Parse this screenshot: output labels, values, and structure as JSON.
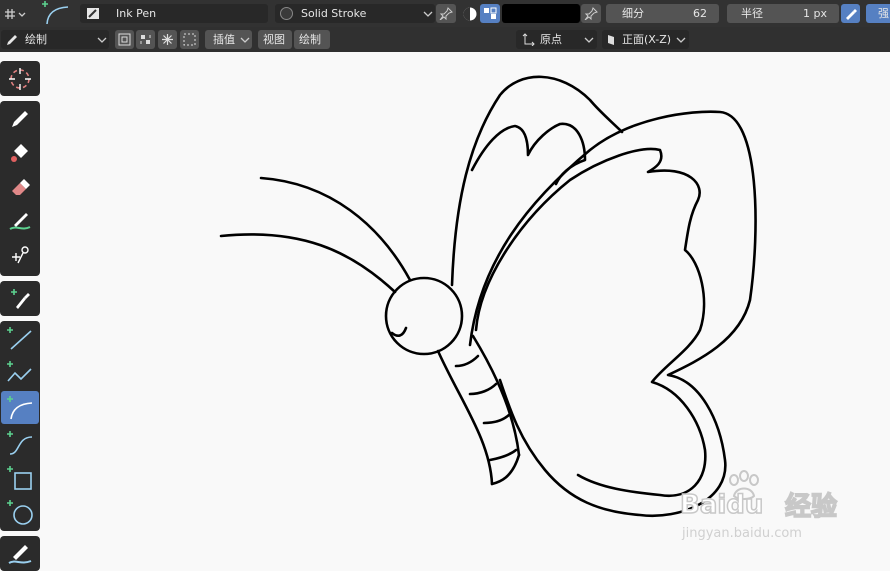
{
  "header": {
    "brush_name": "Ink Pen",
    "material_name": "Solid Stroke",
    "subdivision_label": "细分",
    "subdivision_value": "62",
    "radius_label": "半径",
    "radius_value": "1 px",
    "strength_label_partial": "强"
  },
  "toolbar2": {
    "mode_label": "绘制",
    "interpolate_label": "插值",
    "view_label": "视图",
    "draw_label": "绘制",
    "origin_label": "原点",
    "orientation_label": "正面(X-Z)"
  },
  "colors": {
    "active_tool": "#5680c2",
    "stroke": "#000000",
    "canvas_bg": "#f9f9f9"
  },
  "tools": [
    {
      "name": "cursor-tool",
      "icon": "crosshair-icon",
      "active": false
    },
    {
      "name": "draw-tool",
      "icon": "pencil-icon",
      "active": false
    },
    {
      "name": "fill-tool",
      "icon": "bucket-icon",
      "active": false
    },
    {
      "name": "erase-tool",
      "icon": "eraser-icon",
      "active": false
    },
    {
      "name": "tint-tool",
      "icon": "brush-icon",
      "active": false
    },
    {
      "name": "cutter-tool",
      "icon": "scissors-icon",
      "active": false
    },
    {
      "name": "eyedropper-tool",
      "icon": "eyedropper-icon",
      "active": false
    },
    {
      "name": "line-tool",
      "icon": "line-icon",
      "active": false
    },
    {
      "name": "polyline-tool",
      "icon": "polyline-icon",
      "active": false
    },
    {
      "name": "arc-tool",
      "icon": "arc-icon",
      "active": true
    },
    {
      "name": "curve-tool",
      "icon": "curve-icon",
      "active": false
    },
    {
      "name": "box-tool",
      "icon": "box-icon",
      "active": false
    },
    {
      "name": "circle-tool",
      "icon": "circle-icon",
      "active": false
    },
    {
      "name": "annotate-tool",
      "icon": "annotate-icon",
      "active": false
    }
  ],
  "watermark": {
    "text_latin": "Bai",
    "text_du": "du",
    "text_cn": "经验",
    "url": "jingyan.baidu.com"
  }
}
